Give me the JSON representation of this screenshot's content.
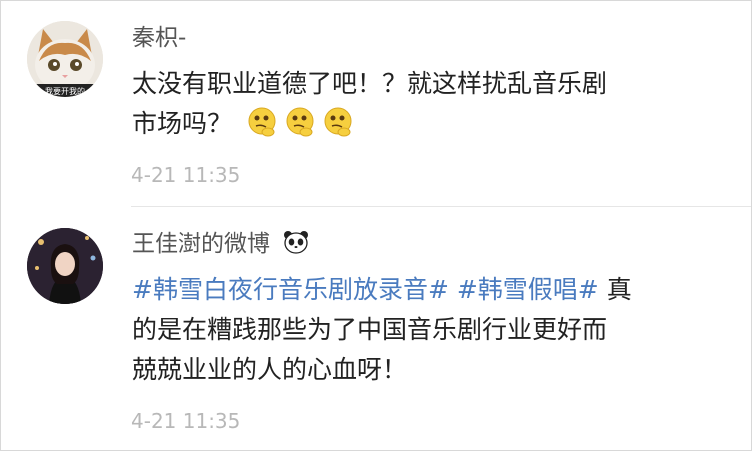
{
  "comments": [
    {
      "username": "秦枳-",
      "avatar_caption": "我要开我的",
      "text": "太没有职业道德了吧！？就这样扰乱音乐剧",
      "text2": "市场吗？",
      "emojis": [
        "thinking-face-icon",
        "thinking-face-icon",
        "thinking-face-icon"
      ],
      "time": "4-21 11:35"
    },
    {
      "username": "王佳澍的微博",
      "badge_icon": "panda-icon",
      "topic1": "#韩雪白夜行音乐剧放录音#",
      "topic2": "#韩雪假唱#",
      "text_line1_tail": " 真",
      "text_line2": "的是在糟践那些为了中国音乐剧行业更好而",
      "text_line3": "兢兢业业的人的心血呀！",
      "time": "4-21 11:35"
    }
  ],
  "colors": {
    "topic": "#4a7bbf",
    "time": "#b8b8b8",
    "username": "#555555",
    "text": "#222222"
  }
}
